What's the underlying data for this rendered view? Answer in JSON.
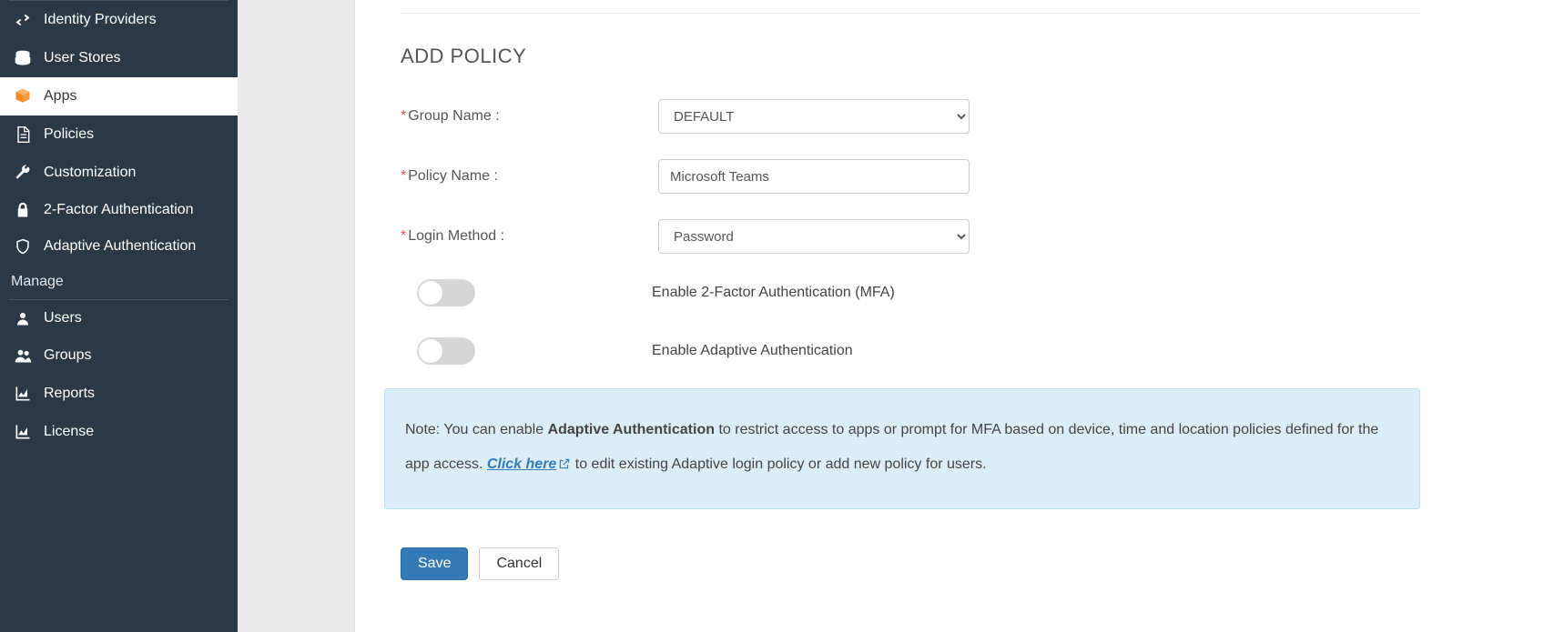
{
  "sidebar": {
    "items": [
      {
        "label": "Identity Providers"
      },
      {
        "label": "User Stores"
      },
      {
        "label": "Apps"
      },
      {
        "label": "Policies"
      },
      {
        "label": "Customization"
      },
      {
        "label": "2-Factor Authentication"
      },
      {
        "label": "Adaptive Authentication"
      }
    ],
    "section_manage": "Manage",
    "manage_items": [
      {
        "label": "Users"
      },
      {
        "label": "Groups"
      },
      {
        "label": "Reports"
      },
      {
        "label": "License"
      }
    ]
  },
  "page": {
    "title": "ADD POLICY"
  },
  "form": {
    "group_name_label": "Group Name :",
    "group_name_value": "DEFAULT",
    "policy_name_label": "Policy Name :",
    "policy_name_value": "Microsoft Teams",
    "login_method_label": "Login Method :",
    "login_method_value": "Password",
    "mfa_label": "Enable 2-Factor Authentication (MFA)",
    "adaptive_label": "Enable Adaptive Authentication"
  },
  "note": {
    "prefix": "Note: You can enable ",
    "strong": "Adaptive Authentication",
    "mid": " to restrict access to apps or prompt for MFA based on device, time and location policies defined for the app access. ",
    "link": "Click here",
    "suffix": " to edit existing Adaptive login policy or add new policy for users."
  },
  "buttons": {
    "save": "Save",
    "cancel": "Cancel"
  }
}
